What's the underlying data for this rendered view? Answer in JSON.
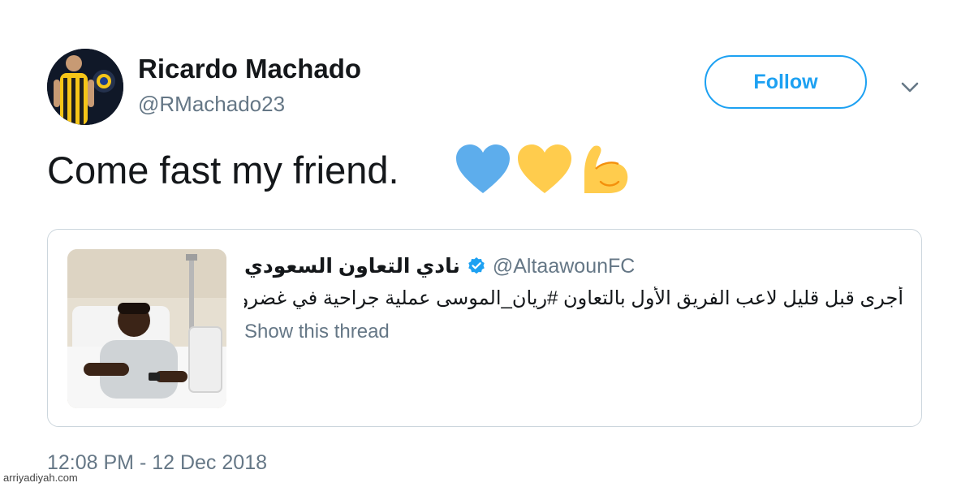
{
  "tweet": {
    "author": {
      "display_name": "Ricardo Machado",
      "handle": "@RMachado23",
      "avatar_icon": "profile-photo"
    },
    "follow_label": "Follow",
    "menu_icon": "chevron-down-icon",
    "text": "Come fast my friend.",
    "emojis": [
      "blue-heart-icon",
      "yellow-heart-icon",
      "flexed-biceps-icon"
    ],
    "timestamp": "12:08 PM - 12 Dec 2018"
  },
  "quoted_tweet": {
    "display_name": "نادي التعاون السعودي",
    "verified": true,
    "handle": "@AltaawounFC",
    "text": "أجرى قبل قليل لاعب الفريق الأول بالتعاون #ريان_الموسى عملية جراحية في غضروف...",
    "show_thread_label": "Show this thread",
    "media_icon": "hospital-bed-photo"
  },
  "watermark": "arriyadiyah.com",
  "colors": {
    "accent": "#1da1f2",
    "text": "#14171a",
    "secondary": "#657786",
    "border": "#ccd6dd",
    "blue_heart": "#5dadec",
    "yellow_heart": "#ffcc4d"
  }
}
